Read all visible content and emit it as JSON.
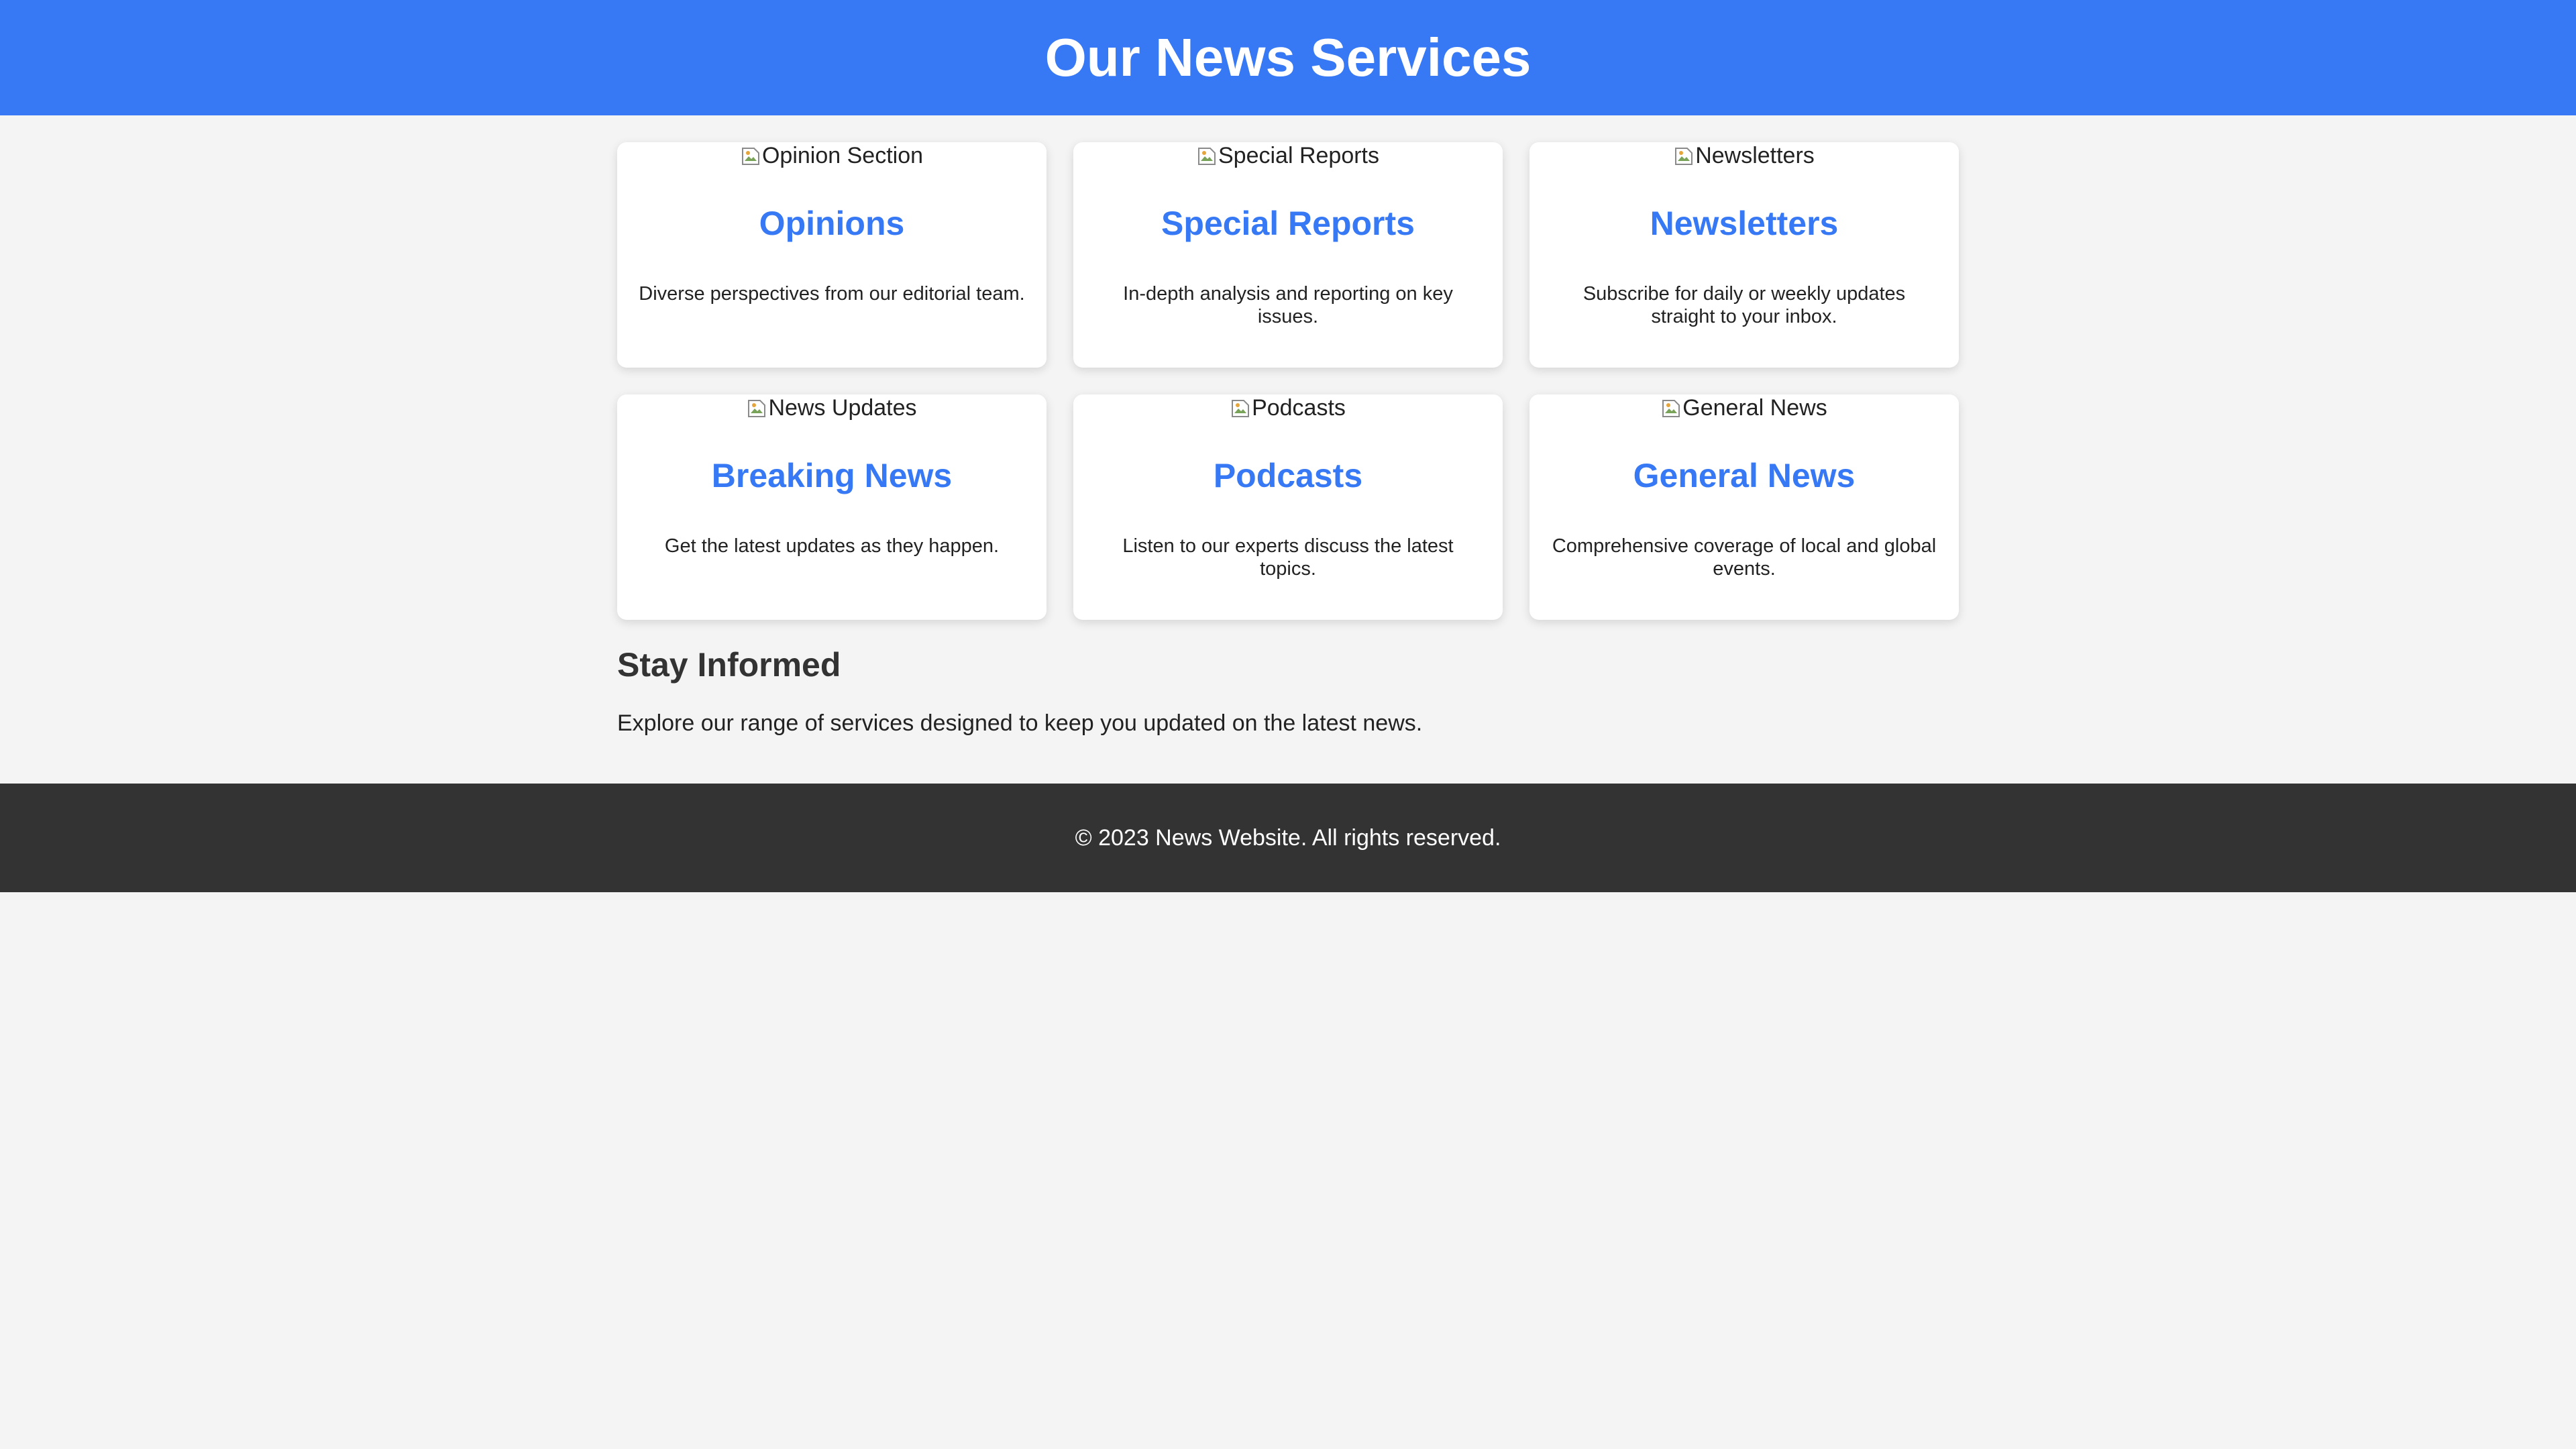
{
  "header": {
    "title": "Our News Services"
  },
  "services": [
    {
      "image_alt": "Opinion Section",
      "title": "Opinions",
      "description": "Diverse perspectives from our editorial team."
    },
    {
      "image_alt": "Special Reports",
      "title": "Special Reports",
      "description": "In-depth analysis and reporting on key issues."
    },
    {
      "image_alt": "Newsletters",
      "title": "Newsletters",
      "description": "Subscribe for daily or weekly updates straight to your inbox."
    },
    {
      "image_alt": "News Updates",
      "title": "Breaking News",
      "description": "Get the latest updates as they happen."
    },
    {
      "image_alt": "Podcasts",
      "title": "Podcasts",
      "description": "Listen to our experts discuss the latest topics."
    },
    {
      "image_alt": "General News",
      "title": "General News",
      "description": "Comprehensive coverage of local and global events."
    }
  ],
  "info": {
    "heading": "Stay Informed",
    "text": "Explore our range of services designed to keep you updated on the latest news."
  },
  "footer": {
    "copyright": "© 2023 News Website. All rights reserved."
  },
  "colors": {
    "brand_blue": "#3779f5",
    "page_background": "#f4f4f4",
    "footer_background": "#333333",
    "card_background": "#ffffff"
  },
  "icons": {
    "card_image": "broken-image-icon"
  }
}
